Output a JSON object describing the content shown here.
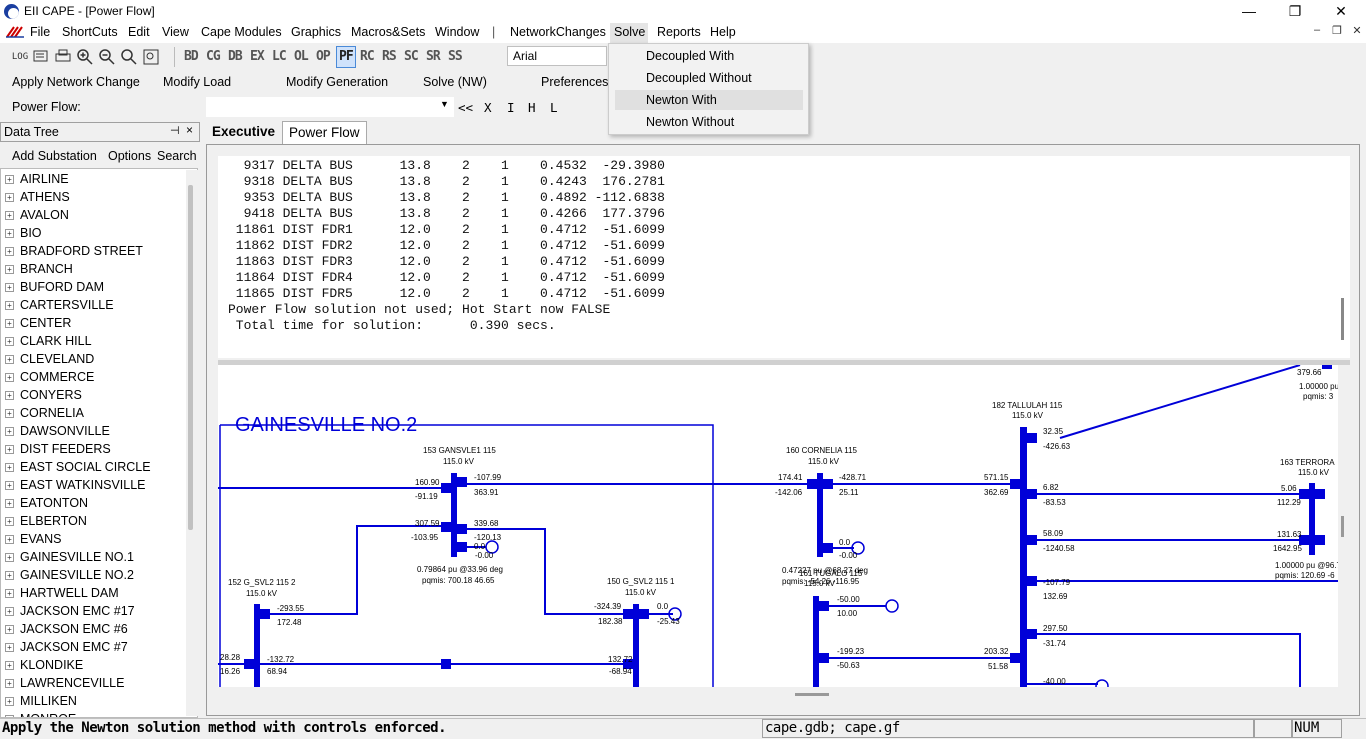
{
  "window": {
    "title": "EII CAPE - [Power Flow]",
    "minimize": "—",
    "restore": "❐",
    "close": "✕"
  },
  "menu": [
    "File",
    "ShortCuts",
    "Edit",
    "View",
    "Cape Modules",
    "Graphics",
    "Macros&Sets",
    "Window",
    "|",
    "NetworkChanges",
    "Solve",
    "Reports",
    "Help"
  ],
  "mdi_controls": [
    "–",
    "❐",
    "✕"
  ],
  "toolbar": {
    "icons": [
      "LOG",
      "print-preview",
      "print",
      "zoom-in",
      "zoom-out",
      "zoom",
      "zoom-fit"
    ],
    "modules": [
      "BD",
      "CG",
      "DB",
      "EX",
      "LC",
      "OL",
      "OP",
      "PF",
      "RC",
      "RS",
      "SC",
      "SR",
      "SS"
    ],
    "active_module": "PF",
    "font": "Arial"
  },
  "actions": [
    "Apply Network Change",
    "Modify Load",
    "Modify Generation",
    "Solve (NW)",
    "Preferences"
  ],
  "power_flow_bar": {
    "label": "Power Flow:",
    "value": "",
    "buttons": [
      "<<",
      "X",
      "I",
      "H",
      "L"
    ]
  },
  "solve_menu": {
    "items": [
      "Decoupled With",
      "Decoupled Without",
      "Newton With",
      "Newton Without"
    ],
    "highlighted": 2
  },
  "data_tree": {
    "title": "Data Tree",
    "pin": "⊣",
    "close": "×",
    "tools": [
      "Add Substation",
      "Options",
      "Search"
    ],
    "items": [
      "AIRLINE",
      "ATHENS",
      "AVALON",
      "BIO",
      "BRADFORD STREET",
      "BRANCH",
      "BUFORD DAM",
      "CARTERSVILLE",
      "CENTER",
      "CLARK HILL",
      "CLEVELAND",
      "COMMERCE",
      "CONYERS",
      "CORNELIA",
      "DAWSONVILLE",
      "DIST FEEDERS",
      "EAST SOCIAL CIRCLE",
      "EAST WATKINSVILLE",
      "EATONTON",
      "ELBERTON",
      "EVANS",
      "GAINESVILLE NO.1",
      "GAINESVILLE NO.2",
      "HARTWELL DAM",
      "JACKSON EMC #17",
      "JACKSON EMC #6",
      "JACKSON EMC #7",
      "KLONDIKE",
      "LAWRENCEVILLE",
      "MILLIKEN",
      "MONROE"
    ]
  },
  "tabs": [
    "Executive",
    "Power Flow"
  ],
  "active_tab": 1,
  "output_lines": [
    "  9317 DELTA BUS      13.8    2    1    0.4532  -29.3980",
    "  9318 DELTA BUS      13.8    2    1    0.4243  176.2781",
    "  9353 DELTA BUS      13.8    2    1    0.4892 -112.6838",
    "  9418 DELTA BUS      13.8    2    1    0.4266  177.3796",
    " 11861 DIST FDR1      12.0    2    1    0.4712  -51.6099",
    " 11862 DIST FDR2      12.0    2    1    0.4712  -51.6099",
    " 11863 DIST FDR3      12.0    2    1    0.4712  -51.6099",
    " 11864 DIST FDR4      12.0    2    1    0.4712  -51.6099",
    " 11865 DIST FDR5      12.0    2    1    0.4712  -51.6099",
    "Power Flow solution not used; Hot Start now FALSE",
    " Total time for solution:      0.390 secs."
  ],
  "diagram": {
    "substation_label": "GAINESVILLE NO.2",
    "buses": [
      {
        "name": "153 GANSVLE1 115",
        "kv": "115.0 kV"
      },
      {
        "name": "160 CORNELIA 115",
        "kv": "115.0 kV"
      },
      {
        "name": "182 TALLULAH 115",
        "kv": "115.0 kV"
      },
      {
        "name": "163 TERRORA",
        "kv": "115.0 kV"
      },
      {
        "name": "152 G_SVL2 115 2",
        "kv": "115.0 kV"
      },
      {
        "name": "150 G_SVL2 115 1",
        "kv": "115.0 kV"
      },
      {
        "name": "161 TUGALO 115",
        "kv": "115.0 kV"
      }
    ],
    "flows": {
      "a1": "160.90",
      "a2": "-91.19",
      "a3": "-107.99",
      "a4": "363.91",
      "a5": "307.59",
      "a6": "-103.95",
      "a7": "339.68",
      "a8": "-120.13",
      "a9": "0.0",
      "a10": "-0.00",
      "b1": "174.41",
      "b2": "-142.06",
      "b3": "-428.71",
      "b4": "25.11",
      "b5": "0.0",
      "b6": "-0.00",
      "c1": "571.15",
      "c2": "362.69",
      "c3": "32.35",
      "c4": "-426.63",
      "c5": "6.82",
      "c6": "-83.53",
      "c7": "58.09",
      "c8": "-1240.58",
      "c9": "-107.79",
      "c10": "132.69",
      "c11": "297.50",
      "c12": "-31.74",
      "c13": "-40.00",
      "c14": "203.32",
      "c15": "51.58",
      "d1": "5.06",
      "d2": "112.29",
      "d3": "131.63",
      "d4": "1642.95",
      "d5": "379.66",
      "e1": "-293.55",
      "e2": "172.48",
      "e3": "28.28",
      "e4": "16.26",
      "e5": "-132.72",
      "e6": "68.94",
      "f1": "-324.39",
      "f2": "182.38",
      "f3": "0.0",
      "f4": "-25.43",
      "f5": "132.72",
      "f6": "-68.94",
      "g1": "-50.00",
      "g2": "10.00",
      "g3": "-199.23",
      "g4": "-50.63"
    },
    "voltages": {
      "v153": "0.79864 pu @33.96 deg",
      "v153q": "pqmis: 700.18 46.65",
      "v161": "0.47227 pu @68.27 deg",
      "v161q": "pqmis: -54.26 -116.95",
      "v163": "1.00000 pu @96.7",
      "v163q": "pqmis: 120.69 -6",
      "vtop": "1.00000 pu",
      "vtopq": "pqmis: 3"
    }
  },
  "status": {
    "message": "Apply the Newton solution method with controls enforced.",
    "files": "cape.gdb; cape.gf",
    "num": "NUM"
  },
  "colors": {
    "diagram": "#0000d8",
    "highlight": "#cfe2fb"
  }
}
